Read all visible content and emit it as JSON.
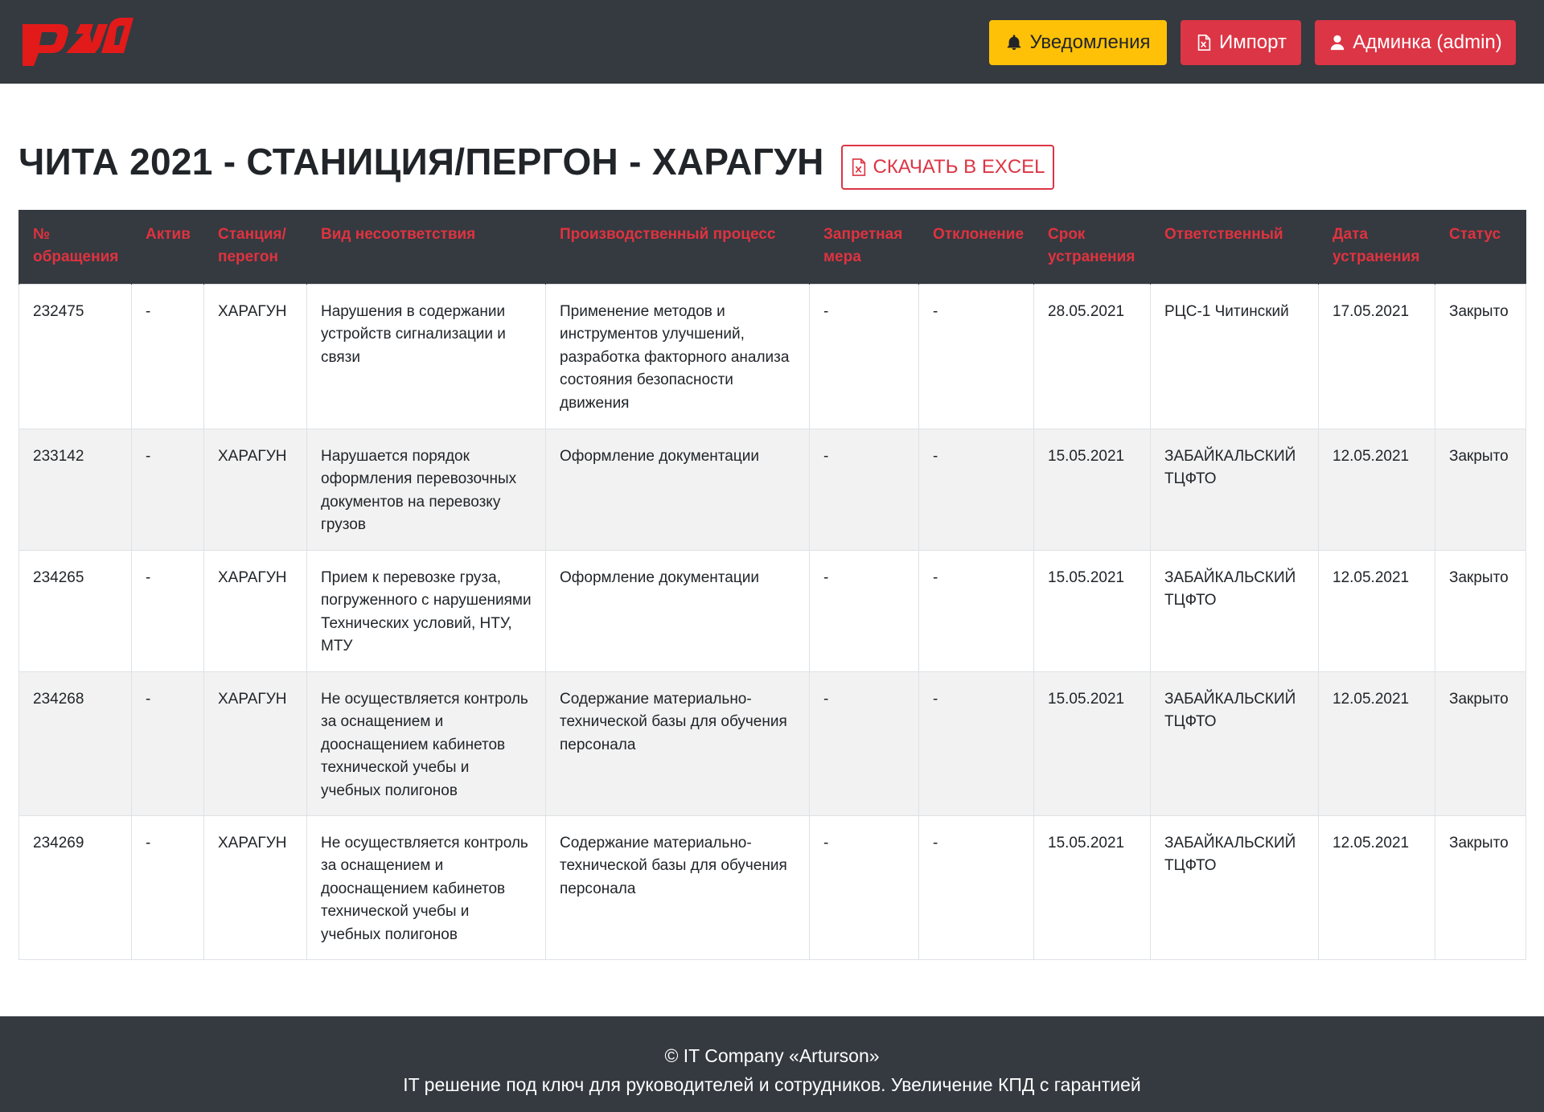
{
  "header": {
    "logo_name": "rzd-logo",
    "notifications_label": "Уведомления",
    "import_label": "Импорт",
    "account_label": "Админка (admin)"
  },
  "title": {
    "text": "ЧИТА 2021 - СТАНИЦИЯ/ПЕРГОН - ХАРАГУН",
    "excel_label": "СКАЧАТЬ В EXCEL"
  },
  "table": {
    "headers": [
      "№ обращения",
      "Актив",
      "Станция/ перегон",
      "Вид несоответствия",
      "Производственный процесс",
      "Запретная мера",
      "Отклонение",
      "Срок устранения",
      "Ответственный",
      "Дата устранения",
      "Статус"
    ],
    "rows": [
      [
        "232475",
        "-",
        "ХАРАГУН",
        "Нарушения в содержании устройств сигнализации и связи",
        "Применение методов и инструментов улучшений, разработка факторного анализа состояния безопасности движения",
        "-",
        "-",
        "28.05.2021",
        "РЦС-1 Читинский",
        "17.05.2021",
        "Закрыто"
      ],
      [
        "233142",
        "-",
        "ХАРАГУН",
        "Нарушается порядок оформления перевозочных документов на перевозку грузов",
        "Оформление документации",
        "-",
        "-",
        "15.05.2021",
        "ЗАБАЙКАЛЬСКИЙ ТЦФТО",
        "12.05.2021",
        "Закрыто"
      ],
      [
        "234265",
        "-",
        "ХАРАГУН",
        "Прием к перевозке груза, погруженного с нарушениями Технических условий, НТУ, МТУ",
        "Оформление документации",
        "-",
        "-",
        "15.05.2021",
        "ЗАБАЙКАЛЬСКИЙ ТЦФТО",
        "12.05.2021",
        "Закрыто"
      ],
      [
        "234268",
        "-",
        "ХАРАГУН",
        "Не осуществляется контроль за оснащением и дооснащением кабинетов технической учебы и учебных полигонов",
        "Содержание материально-технической базы для обучения персонала",
        "-",
        "-",
        "15.05.2021",
        "ЗАБАЙКАЛЬСКИЙ ТЦФТО",
        "12.05.2021",
        "Закрыто"
      ],
      [
        "234269",
        "-",
        "ХАРАГУН",
        "Не осуществляется контроль за оснащением и дооснащением кабинетов технической учебы и учебных полигонов",
        "Содержание материально-технической базы для обучения персонала",
        "-",
        "-",
        "15.05.2021",
        "ЗАБАЙКАЛЬСКИЙ ТЦФТО",
        "12.05.2021",
        "Закрыто"
      ]
    ]
  },
  "footer": {
    "line1": "© IT Company «Arturson»",
    "line2": "IT решение под ключ для руководителей и сотрудников. Увеличение КПД с гарантией"
  },
  "colors": {
    "header_bg": "#343a40",
    "warning": "#ffc107",
    "danger": "#dc3545",
    "header_text": "#e0323f",
    "logo_red": "#e21a1a"
  }
}
